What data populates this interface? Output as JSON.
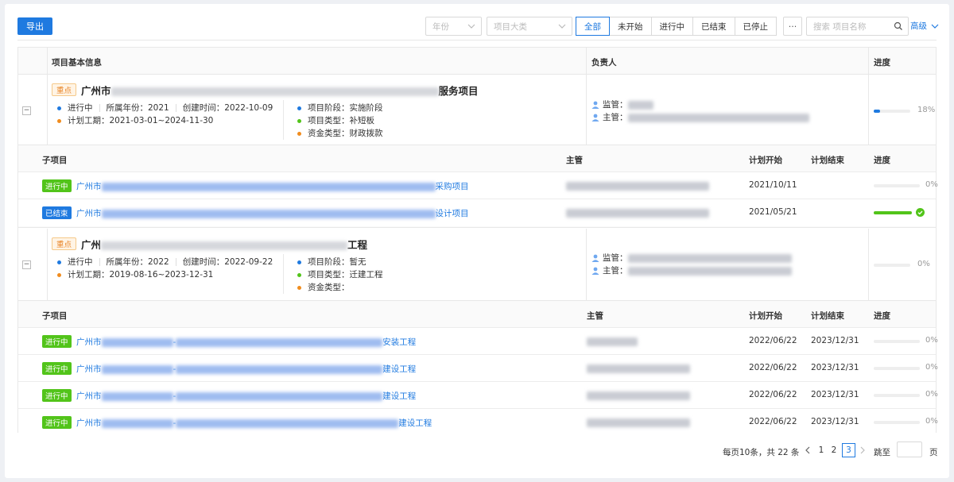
{
  "toolbar": {
    "export_label": "导出",
    "year_placeholder": "年份",
    "category_placeholder": "项目大类",
    "status_tabs": [
      "全部",
      "未开始",
      "进行中",
      "已结束",
      "已停止"
    ],
    "more_label": "···",
    "search_placeholder": "搜索 项目名称",
    "advanced_label": "高级"
  },
  "table": {
    "headers": {
      "basic_info": "项目基本信息",
      "owner": "负责人",
      "progress": "进度"
    },
    "sub_headers": {
      "sub_project": "子项目",
      "supervisor": "主管",
      "plan_start": "计划开始",
      "plan_end": "计划结束",
      "progress": "进度"
    },
    "projects": [
      {
        "key_tag": "重点",
        "title_prefix": "广州市",
        "title_suffix": "服务项目",
        "status": "进行中",
        "year_label": "所属年份：",
        "year": "2021",
        "created_label": "创建时间：",
        "created": "2022-10-09",
        "period_label": "计划工期：",
        "period": "2021-03-01~2024-11-30",
        "stage_label": "项目阶段：",
        "stage": "实施阶段",
        "type_label": "项目类型：",
        "type": "补短板",
        "fund_label": "资金类型：",
        "fund": "财政拨款",
        "monitor_label": "监管：",
        "manager_label": "主管：",
        "progress": 18,
        "progress_text": "18%",
        "subs": [
          {
            "status": "进行中",
            "status_color": "green",
            "name_prefix": "广州市",
            "name_suffix": "采购项目",
            "start": "2021/10/11",
            "end": "",
            "progress": 0,
            "progress_text": "0%"
          },
          {
            "status": "已结束",
            "status_color": "blue",
            "name_prefix": "广州市",
            "name_suffix": "设计项目",
            "start": "2021/05/21",
            "end": "",
            "progress": 100,
            "progress_text": ""
          }
        ]
      },
      {
        "key_tag": "重点",
        "title_prefix": "广州",
        "title_suffix": "工程",
        "status": "进行中",
        "year_label": "所属年份：",
        "year": "2022",
        "created_label": "创建时间：",
        "created": "2022-09-22",
        "period_label": "计划工期：",
        "period": "2019-08-16~2023-12-31",
        "stage_label": "项目阶段：",
        "stage": "暂无",
        "type_label": "项目类型：",
        "type": "迁建工程",
        "fund_label": "资金类型：",
        "fund": "",
        "monitor_label": "监管：",
        "manager_label": "主管：",
        "progress": 0,
        "progress_text": "0%",
        "subs": [
          {
            "status": "进行中",
            "status_color": "green",
            "name_prefix": "广州市",
            "name_mid": "-",
            "name_suffix": "安装工程",
            "start": "2022/06/22",
            "end": "2023/12/31",
            "progress": 0,
            "progress_text": "0%"
          },
          {
            "status": "进行中",
            "status_color": "green",
            "name_prefix": "广州市",
            "name_mid": "-",
            "name_suffix": "建设工程",
            "start": "2022/06/22",
            "end": "2023/12/31",
            "progress": 0,
            "progress_text": "0%"
          },
          {
            "status": "进行中",
            "status_color": "green",
            "name_prefix": "广州市",
            "name_mid": "-",
            "name_suffix": "建设工程",
            "start": "2022/06/22",
            "end": "2023/12/31",
            "progress": 0,
            "progress_text": "0%"
          },
          {
            "status": "进行中",
            "status_color": "green",
            "name_prefix": "广州市",
            "name_mid": "-",
            "name_suffix": "建设工程",
            "start": "2022/06/22",
            "end": "2023/12/31",
            "progress": 0,
            "progress_text": "0%"
          }
        ]
      }
    ]
  },
  "pagination": {
    "summary": "每页10条，共 22 条",
    "pages": [
      "1",
      "2",
      "3"
    ],
    "current": "3",
    "jump_label": "跳至",
    "page_unit": "页"
  },
  "colors": {
    "accent": "#1f7ae0",
    "success": "#52c41a",
    "key_tag": "#e8862a"
  }
}
